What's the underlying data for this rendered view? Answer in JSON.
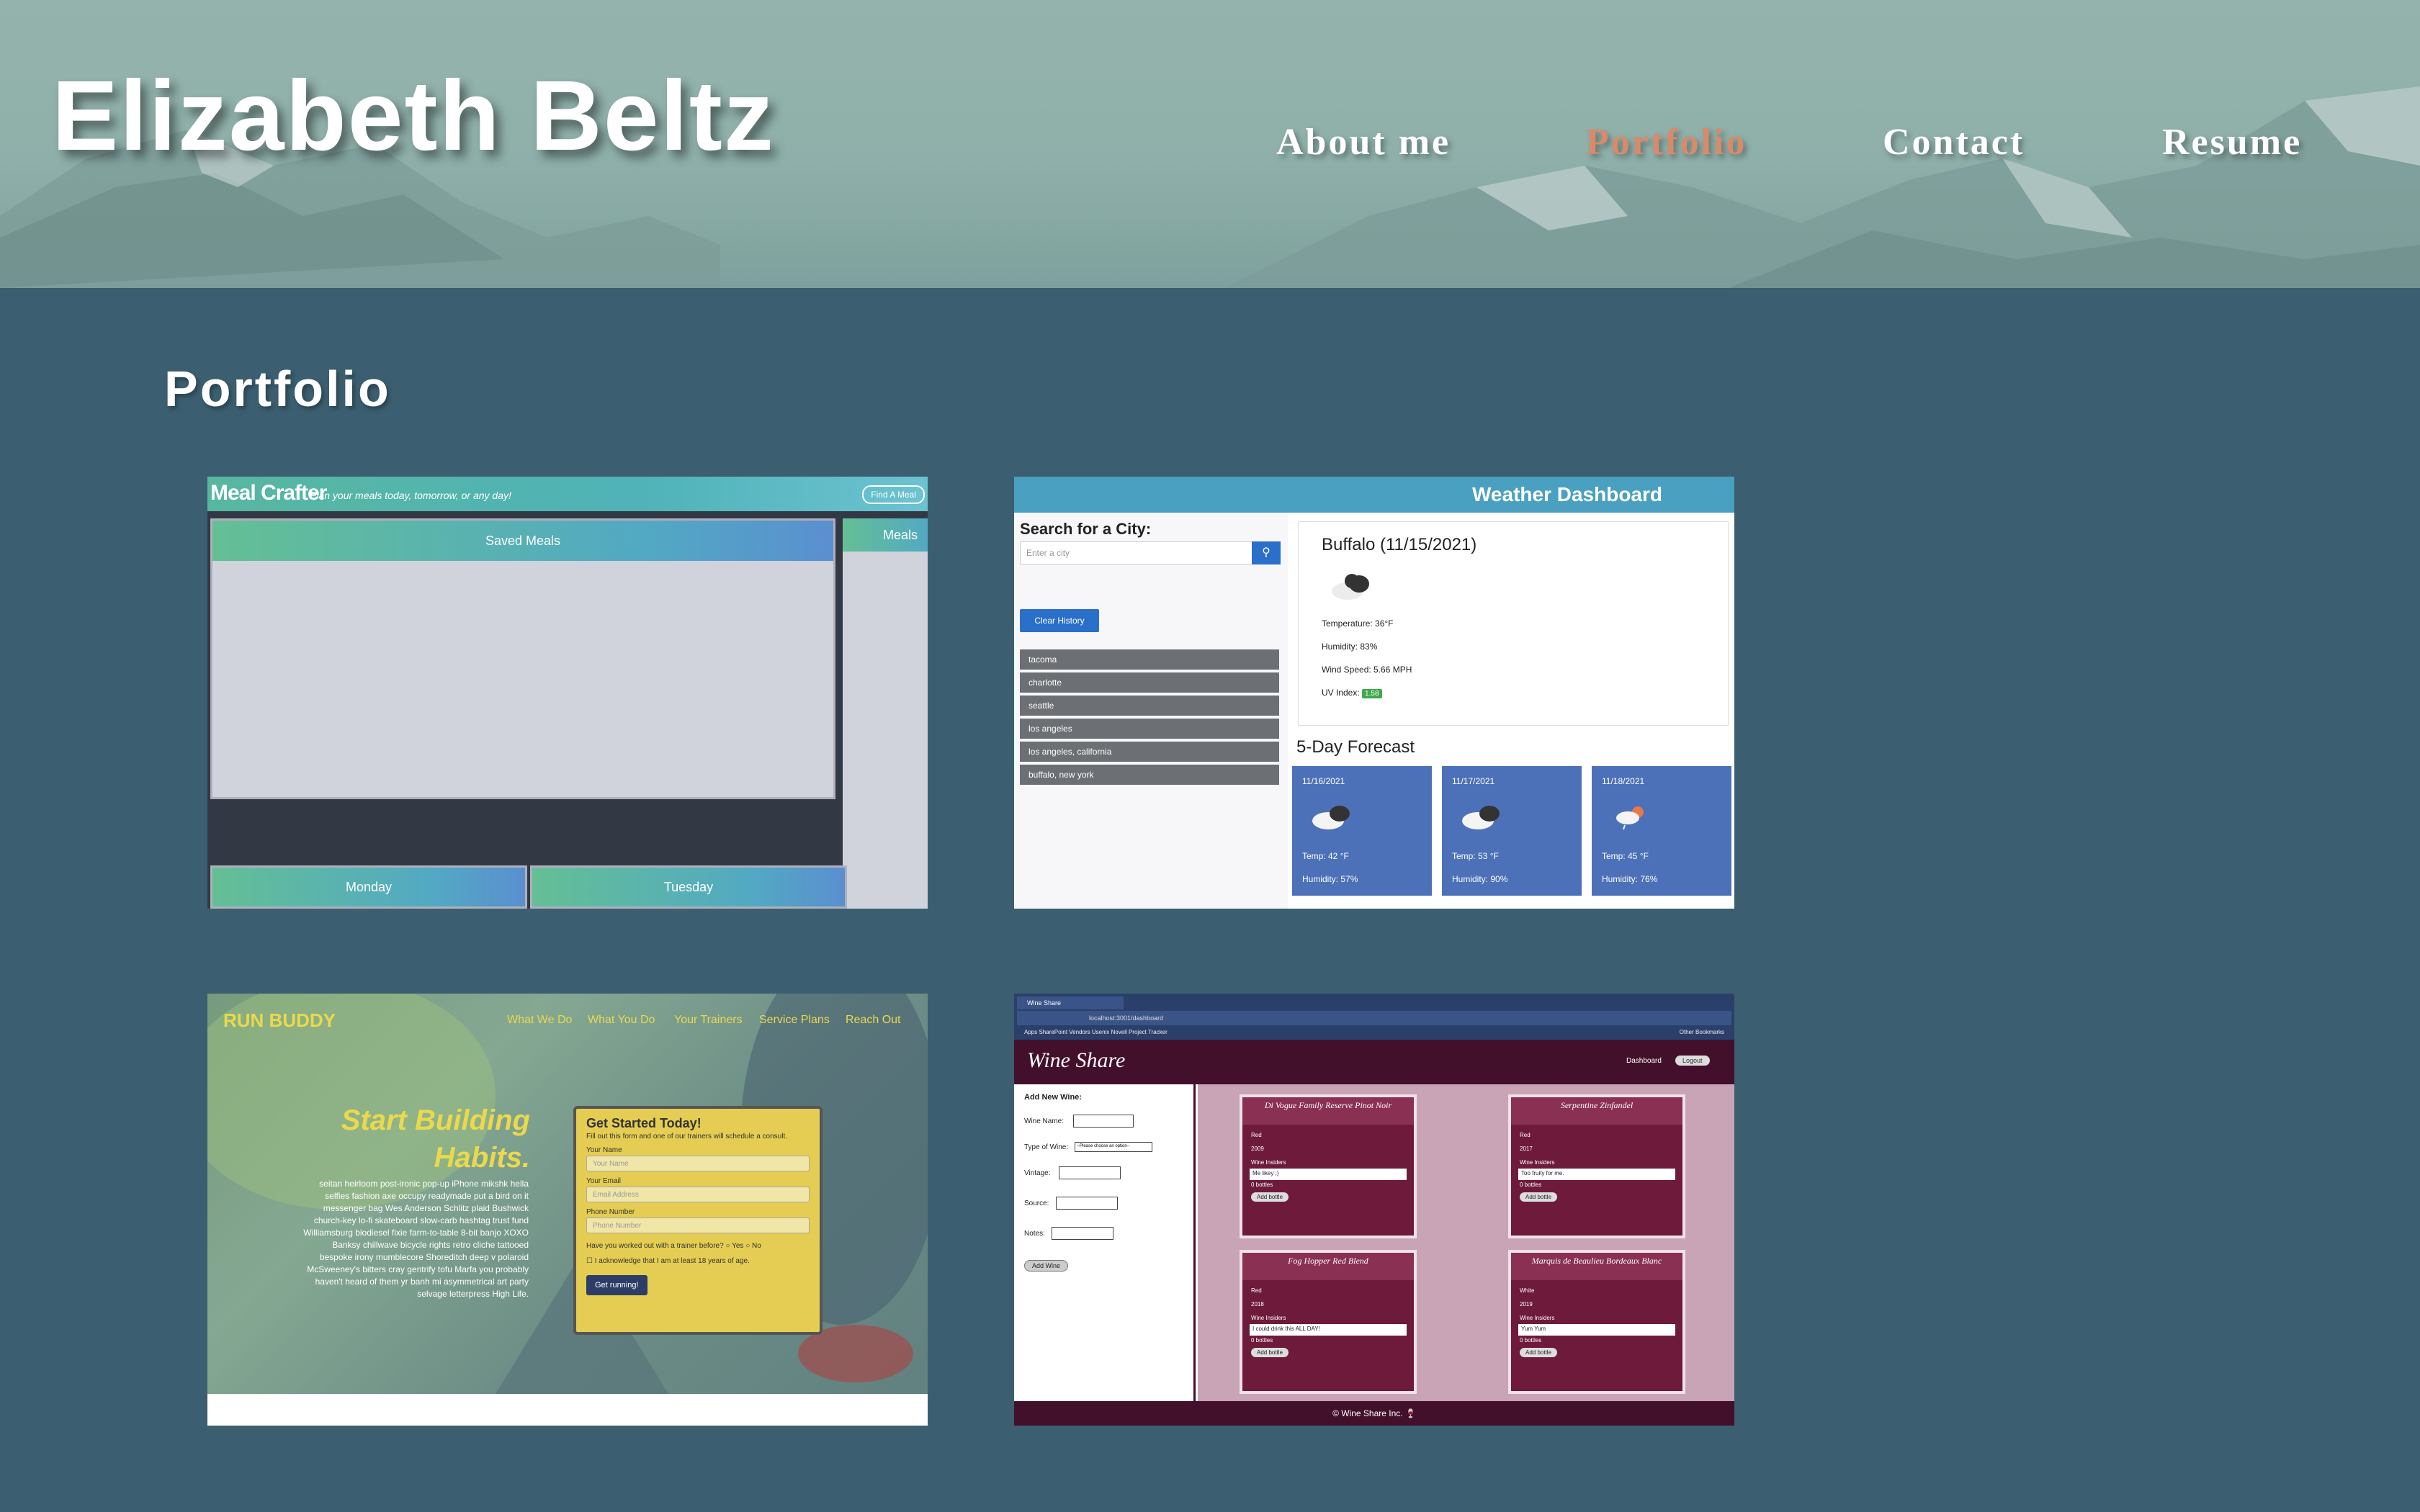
{
  "header": {
    "name": "Elizabeth Beltz",
    "nav": [
      {
        "label": "About me",
        "active": false
      },
      {
        "label": "Portfolio",
        "active": true
      },
      {
        "label": "Contact",
        "active": false
      },
      {
        "label": "Resume",
        "active": false
      }
    ]
  },
  "section": {
    "title": "Portfolio"
  },
  "projects": {
    "meal_crafter": {
      "brand": "Meal Crafter",
      "tagline": "Plan your meals today, tomorrow, or any day!",
      "find_button": "Find A Meal",
      "saved_meals": "Saved Meals",
      "meals": "Meals",
      "days": [
        "Monday",
        "Tuesday"
      ]
    },
    "weather": {
      "title": "Weather Dashboard",
      "search_label": "Search for a City:",
      "search_placeholder": "Enter a city",
      "clear_button": "Clear History",
      "history": [
        "tacoma",
        "charlotte",
        "seattle",
        "los angeles",
        "los angeles, california",
        "buffalo, new york"
      ],
      "city": "Buffalo (11/15/2021)",
      "temperature": "Temperature: 36°F",
      "humidity": "Humidity: 83%",
      "wind": "Wind Speed: 5.66 MPH",
      "uv_label": "UV Index:",
      "uv_value": "1.58",
      "forecast_title": "5-Day Forecast",
      "forecast": [
        {
          "date": "11/16/2021",
          "temp": "Temp: 42 °F",
          "humidity": "Humidity: 57%"
        },
        {
          "date": "11/17/2021",
          "temp": "Temp: 53 °F",
          "humidity": "Humidity: 90%"
        },
        {
          "date": "11/18/2021",
          "temp": "Temp: 45 °F",
          "humidity": "Humidity: 76%"
        }
      ]
    },
    "run_buddy": {
      "logo": "RUN BUDDY",
      "nav": [
        "What We Do",
        "What You Do",
        "Your Trainers",
        "Service Plans",
        "Reach Out"
      ],
      "headline_1": "Start Building",
      "headline_2": "Habits.",
      "body": "seitan heirloom post-ironic pop-up iPhone mikshk hella selfies fashion axe occupy readymade put a bird on it messenger bag Wes Anderson Schlitz plaid Bushwick church-key lo-fi skateboard slow-carb hashtag trust fund Williamsburg biodiesel fixie farm-to-table 8-bit banjo XOXO Banksy chillwave bicycle rights retro cliche tattooed bespoke irony mumblecore Shoreditch deep v polaroid McSweeney's bitters cray gentrify tofu Marfa you probably haven't heard of them yr banh mi asymmetrical art party selvage letterpress High Life.",
      "form_title": "Get Started Today!",
      "form_sub": "Fill out this form and one of our trainers will schedule a consult.",
      "name_label": "Your Name",
      "name_placeholder": "Your Name",
      "email_label": "Your Email",
      "email_placeholder": "Email Address",
      "phone_label": "Phone Number",
      "phone_placeholder": "Phone Number",
      "trainer_q": "Have you worked out with a trainer before?",
      "yes": "Yes",
      "no": "No",
      "ack": "I acknowledge that I am at least 18 years of age.",
      "submit": "Get running!"
    },
    "wine_share": {
      "tab": "Wine Share",
      "url": "localhost:3001/dashboard",
      "bookmarks": "Apps   SharePoint   Vendors   Usenix   Novell   Project Tracker",
      "other_bookmarks": "Other Bookmarks",
      "brand": "Wine Share",
      "dashboard": "Dashboard",
      "logout": "Logout",
      "form_title": "Add New Wine:",
      "fields": [
        "Wine Name:",
        "Type of Wine:",
        "Vintage:",
        "Source:",
        "Notes:"
      ],
      "type_placeholder": "--Please choose an option--",
      "add_button": "Add Wine",
      "wines": [
        {
          "name": "Di Vogue Family Reserve Pinot Noir",
          "type": "Red",
          "year": "2009",
          "insider_label": "Wine Insiders",
          "note": "Me likey ;)",
          "bottles": "0 bottles",
          "button": "Add bottle"
        },
        {
          "name": "Serpentine Zinfandel",
          "type": "Red",
          "year": "2017",
          "insider_label": "Wine Insiders",
          "note": "Too fruity for me.",
          "bottles": "0 bottles",
          "button": "Add bottle"
        },
        {
          "name": "Fog Hopper Red Blend",
          "type": "Red",
          "year": "2018",
          "insider_label": "Wine Insiders",
          "note": "I could drink this ALL DAY!",
          "bottles": "0 bottles",
          "button": "Add bottle"
        },
        {
          "name": "Marquis de Beaulieu Bordeaux Blanc",
          "type": "White",
          "year": "2019",
          "insider_label": "Wine Insiders",
          "note": "Yum Yum",
          "bottles": "0 bottles",
          "button": "Add bottle"
        }
      ],
      "footer": "© Wine Share Inc. 🍷"
    }
  }
}
